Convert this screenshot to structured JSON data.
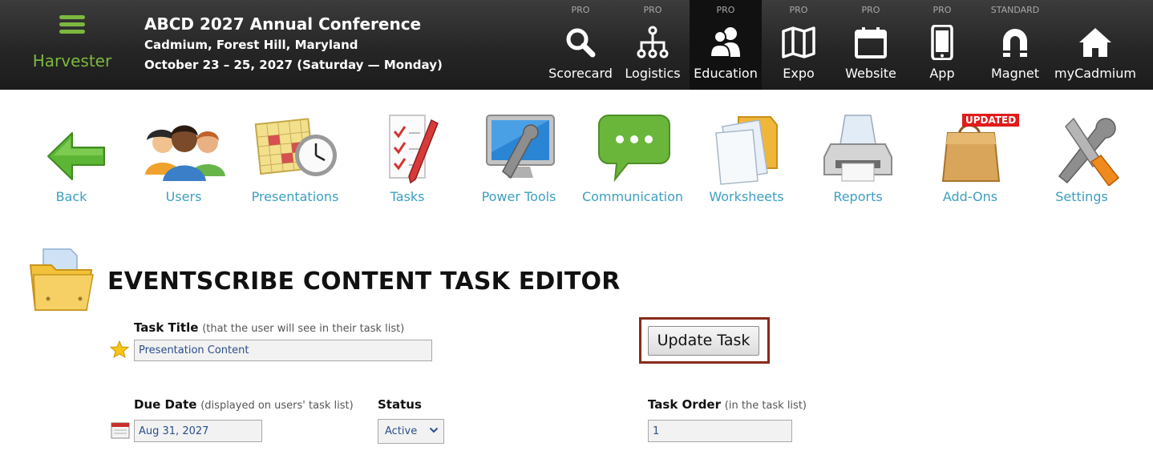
{
  "app": {
    "name": "Harvester"
  },
  "conference": {
    "title": "ABCD 2027 Annual Conference",
    "location": "Cadmium, Forest Hill, Maryland",
    "dates": "October 23 – 25, 2027 (Saturday — Monday)"
  },
  "modules": [
    {
      "tier": "PRO",
      "label": "Scorecard",
      "icon": "search-icon"
    },
    {
      "tier": "PRO",
      "label": "Logistics",
      "icon": "network-icon"
    },
    {
      "tier": "PRO",
      "label": "Education",
      "icon": "users-icon",
      "active": true
    },
    {
      "tier": "PRO",
      "label": "Expo",
      "icon": "map-icon"
    },
    {
      "tier": "PRO",
      "label": "Website",
      "icon": "calendar-icon"
    },
    {
      "tier": "PRO",
      "label": "App",
      "icon": "phone-icon"
    },
    {
      "tier": "STANDARD",
      "label": "Magnet",
      "icon": "magnet-icon"
    },
    {
      "tier": "",
      "label": "myCadmium",
      "icon": "home-icon"
    }
  ],
  "nav": [
    {
      "label": "Back",
      "icon": "back-arrow-icon"
    },
    {
      "label": "Users",
      "icon": "users-group-icon"
    },
    {
      "label": "Presentations",
      "icon": "calendar-clock-icon"
    },
    {
      "label": "Tasks",
      "icon": "checklist-icon"
    },
    {
      "label": "Power Tools",
      "icon": "monitor-wrench-icon"
    },
    {
      "label": "Communication",
      "icon": "chat-bubble-icon"
    },
    {
      "label": "Worksheets",
      "icon": "documents-folder-icon"
    },
    {
      "label": "Reports",
      "icon": "printer-icon"
    },
    {
      "label": "Add-Ons",
      "icon": "shopping-bag-icon",
      "badge": "UPDATED"
    },
    {
      "label": "Settings",
      "icon": "tools-icon"
    }
  ],
  "editor": {
    "title": "EVENTSCRIBE CONTENT TASK EDITOR",
    "task_title": {
      "label": "Task Title",
      "hint": "(that the user will see in their task list)",
      "value": "Presentation Content"
    },
    "due_date": {
      "label": "Due Date",
      "hint": "(displayed on users' task list)",
      "value": "Aug 31, 2027"
    },
    "status": {
      "label": "Status",
      "value": "Active"
    },
    "task_order": {
      "label": "Task Order",
      "hint": "(in the task list)",
      "value": "1"
    },
    "update_button": "Update Task"
  },
  "colors": {
    "accent_green": "#7cb83f",
    "link_blue": "#3d9fc0",
    "highlight_border": "#8a2a1a",
    "topbar": "#262626"
  }
}
